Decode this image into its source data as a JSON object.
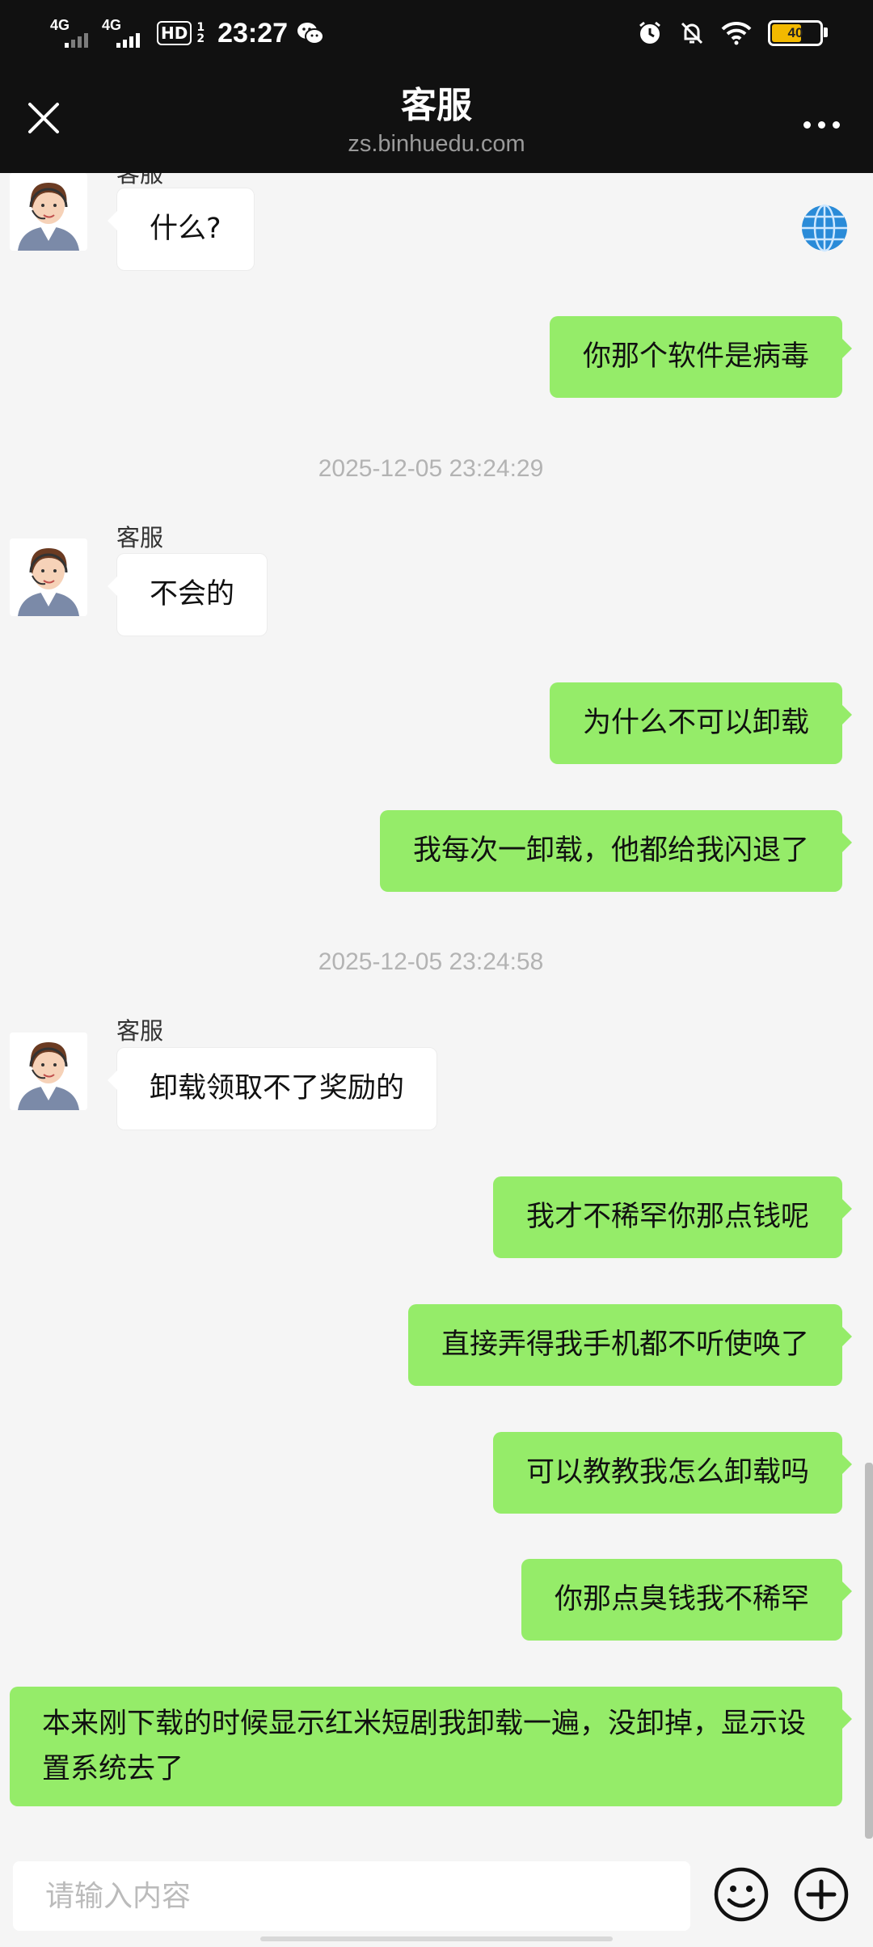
{
  "status_bar": {
    "sim1": "4G",
    "sim2": "4G",
    "hd_label": "HD",
    "hd_sub1": "1",
    "hd_sub2": "2",
    "time": "23:27",
    "battery_level": "40",
    "icons": [
      "wechat-icon",
      "alarm-icon",
      "mute-bell-icon",
      "wifi-icon",
      "battery-icon"
    ]
  },
  "nav": {
    "title": "客服",
    "subtitle": "zs.binhuedu.com"
  },
  "chat": {
    "sender_top": "客服",
    "messages": [
      {
        "type": "in",
        "text": "什么?"
      },
      {
        "type": "out",
        "text": "你那个软件是病毒"
      },
      {
        "type": "timestamp",
        "text": "2025-12-05 23:24:29"
      },
      {
        "type": "in",
        "sender": "客服",
        "text": "不会的"
      },
      {
        "type": "out",
        "text": "为什么不可以卸载"
      },
      {
        "type": "out",
        "text": "我每次一卸载，他都给我闪退了"
      },
      {
        "type": "timestamp",
        "text": "2025-12-05 23:24:58"
      },
      {
        "type": "in",
        "sender": "客服",
        "text": "卸载领取不了奖励的"
      },
      {
        "type": "out",
        "text": "我才不稀罕你那点钱呢"
      },
      {
        "type": "out",
        "text": "直接弄得我手机都不听使唤了"
      },
      {
        "type": "out",
        "text": "可以教教我怎么卸载吗"
      },
      {
        "type": "out",
        "text": "你那点臭钱我不稀罕"
      },
      {
        "type": "out",
        "text": "本来刚下载的时候显示红米短剧我卸载一遍，没卸掉，显示设置系统去了"
      }
    ]
  },
  "input": {
    "placeholder": "请输入内容",
    "value": ""
  },
  "colors": {
    "header_bg": "#111111",
    "chat_bg": "#f5f5f5",
    "outgoing_bubble": "#95ec69",
    "incoming_bubble": "#ffffff",
    "timestamp_text": "#b3b3b3"
  }
}
